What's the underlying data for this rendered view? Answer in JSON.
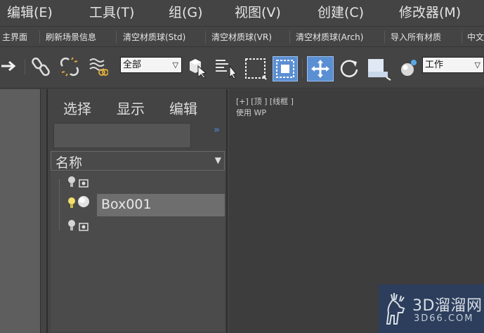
{
  "menubar": {
    "items": [
      {
        "label": "编辑(E)"
      },
      {
        "label": "工具(T)"
      },
      {
        "label": "组(G)"
      },
      {
        "label": "视图(V)"
      },
      {
        "label": "创建(C)"
      },
      {
        "label": "修改器(M)"
      }
    ]
  },
  "scriptbar": {
    "items": [
      {
        "label": "主界面"
      },
      {
        "label": "刷新场景信息"
      },
      {
        "label": "清空材质球(Std)"
      },
      {
        "label": "清空材质球(VR)"
      },
      {
        "label": "清空材质球(Arch)"
      },
      {
        "label": "导入所有材质"
      },
      {
        "label": "中文"
      }
    ]
  },
  "toolbar": {
    "selection_filter": "全部",
    "coordinate_system": "工作",
    "icons": [
      "redo-arrow-icon",
      "link-icon",
      "unlink-icon",
      "bind-space-warp-icon",
      "select-object-icon",
      "select-by-name-icon",
      "rectangular-selection-icon",
      "window-crossing-icon",
      "select-and-move-icon",
      "select-and-rotate-icon",
      "select-and-scale-icon",
      "reference-coordinate-icon"
    ],
    "active_color": "#5b8fd4"
  },
  "explorer": {
    "menu": {
      "select": "选择",
      "display": "显示",
      "edit": "编辑"
    },
    "column_header": "名称",
    "rows": [
      {
        "label": "",
        "light_on": false
      },
      {
        "label": "Box001",
        "light_on": true,
        "selected": true
      },
      {
        "label": "",
        "light_on": false
      }
    ]
  },
  "viewport": {
    "label": "[+] [顶 ] [线框 ]",
    "sublabel": "使用 WP"
  },
  "watermark": {
    "brand": "3D溜溜网",
    "url": "3D66.COM"
  }
}
